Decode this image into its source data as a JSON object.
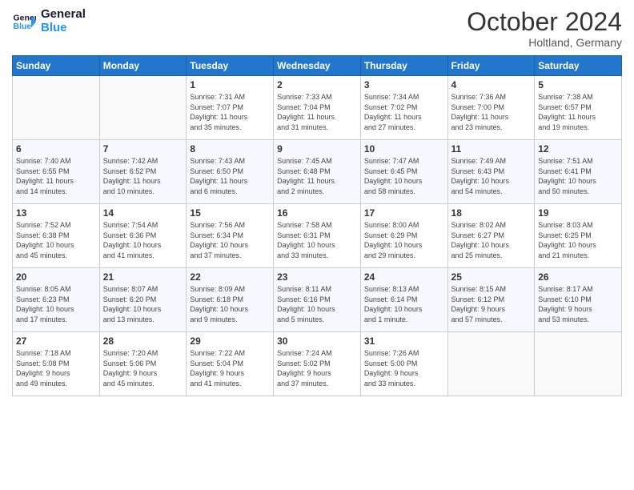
{
  "header": {
    "logo_line1": "General",
    "logo_line2": "Blue",
    "month_title": "October 2024",
    "location": "Holtland, Germany"
  },
  "weekdays": [
    "Sunday",
    "Monday",
    "Tuesday",
    "Wednesday",
    "Thursday",
    "Friday",
    "Saturday"
  ],
  "weeks": [
    [
      {
        "day": "",
        "detail": ""
      },
      {
        "day": "",
        "detail": ""
      },
      {
        "day": "1",
        "detail": "Sunrise: 7:31 AM\nSunset: 7:07 PM\nDaylight: 11 hours\nand 35 minutes."
      },
      {
        "day": "2",
        "detail": "Sunrise: 7:33 AM\nSunset: 7:04 PM\nDaylight: 11 hours\nand 31 minutes."
      },
      {
        "day": "3",
        "detail": "Sunrise: 7:34 AM\nSunset: 7:02 PM\nDaylight: 11 hours\nand 27 minutes."
      },
      {
        "day": "4",
        "detail": "Sunrise: 7:36 AM\nSunset: 7:00 PM\nDaylight: 11 hours\nand 23 minutes."
      },
      {
        "day": "5",
        "detail": "Sunrise: 7:38 AM\nSunset: 6:57 PM\nDaylight: 11 hours\nand 19 minutes."
      }
    ],
    [
      {
        "day": "6",
        "detail": "Sunrise: 7:40 AM\nSunset: 6:55 PM\nDaylight: 11 hours\nand 14 minutes."
      },
      {
        "day": "7",
        "detail": "Sunrise: 7:42 AM\nSunset: 6:52 PM\nDaylight: 11 hours\nand 10 minutes."
      },
      {
        "day": "8",
        "detail": "Sunrise: 7:43 AM\nSunset: 6:50 PM\nDaylight: 11 hours\nand 6 minutes."
      },
      {
        "day": "9",
        "detail": "Sunrise: 7:45 AM\nSunset: 6:48 PM\nDaylight: 11 hours\nand 2 minutes."
      },
      {
        "day": "10",
        "detail": "Sunrise: 7:47 AM\nSunset: 6:45 PM\nDaylight: 10 hours\nand 58 minutes."
      },
      {
        "day": "11",
        "detail": "Sunrise: 7:49 AM\nSunset: 6:43 PM\nDaylight: 10 hours\nand 54 minutes."
      },
      {
        "day": "12",
        "detail": "Sunrise: 7:51 AM\nSunset: 6:41 PM\nDaylight: 10 hours\nand 50 minutes."
      }
    ],
    [
      {
        "day": "13",
        "detail": "Sunrise: 7:52 AM\nSunset: 6:38 PM\nDaylight: 10 hours\nand 45 minutes."
      },
      {
        "day": "14",
        "detail": "Sunrise: 7:54 AM\nSunset: 6:36 PM\nDaylight: 10 hours\nand 41 minutes."
      },
      {
        "day": "15",
        "detail": "Sunrise: 7:56 AM\nSunset: 6:34 PM\nDaylight: 10 hours\nand 37 minutes."
      },
      {
        "day": "16",
        "detail": "Sunrise: 7:58 AM\nSunset: 6:31 PM\nDaylight: 10 hours\nand 33 minutes."
      },
      {
        "day": "17",
        "detail": "Sunrise: 8:00 AM\nSunset: 6:29 PM\nDaylight: 10 hours\nand 29 minutes."
      },
      {
        "day": "18",
        "detail": "Sunrise: 8:02 AM\nSunset: 6:27 PM\nDaylight: 10 hours\nand 25 minutes."
      },
      {
        "day": "19",
        "detail": "Sunrise: 8:03 AM\nSunset: 6:25 PM\nDaylight: 10 hours\nand 21 minutes."
      }
    ],
    [
      {
        "day": "20",
        "detail": "Sunrise: 8:05 AM\nSunset: 6:23 PM\nDaylight: 10 hours\nand 17 minutes."
      },
      {
        "day": "21",
        "detail": "Sunrise: 8:07 AM\nSunset: 6:20 PM\nDaylight: 10 hours\nand 13 minutes."
      },
      {
        "day": "22",
        "detail": "Sunrise: 8:09 AM\nSunset: 6:18 PM\nDaylight: 10 hours\nand 9 minutes."
      },
      {
        "day": "23",
        "detail": "Sunrise: 8:11 AM\nSunset: 6:16 PM\nDaylight: 10 hours\nand 5 minutes."
      },
      {
        "day": "24",
        "detail": "Sunrise: 8:13 AM\nSunset: 6:14 PM\nDaylight: 10 hours\nand 1 minute."
      },
      {
        "day": "25",
        "detail": "Sunrise: 8:15 AM\nSunset: 6:12 PM\nDaylight: 9 hours\nand 57 minutes."
      },
      {
        "day": "26",
        "detail": "Sunrise: 8:17 AM\nSunset: 6:10 PM\nDaylight: 9 hours\nand 53 minutes."
      }
    ],
    [
      {
        "day": "27",
        "detail": "Sunrise: 7:18 AM\nSunset: 5:08 PM\nDaylight: 9 hours\nand 49 minutes."
      },
      {
        "day": "28",
        "detail": "Sunrise: 7:20 AM\nSunset: 5:06 PM\nDaylight: 9 hours\nand 45 minutes."
      },
      {
        "day": "29",
        "detail": "Sunrise: 7:22 AM\nSunset: 5:04 PM\nDaylight: 9 hours\nand 41 minutes."
      },
      {
        "day": "30",
        "detail": "Sunrise: 7:24 AM\nSunset: 5:02 PM\nDaylight: 9 hours\nand 37 minutes."
      },
      {
        "day": "31",
        "detail": "Sunrise: 7:26 AM\nSunset: 5:00 PM\nDaylight: 9 hours\nand 33 minutes."
      },
      {
        "day": "",
        "detail": ""
      },
      {
        "day": "",
        "detail": ""
      }
    ]
  ]
}
